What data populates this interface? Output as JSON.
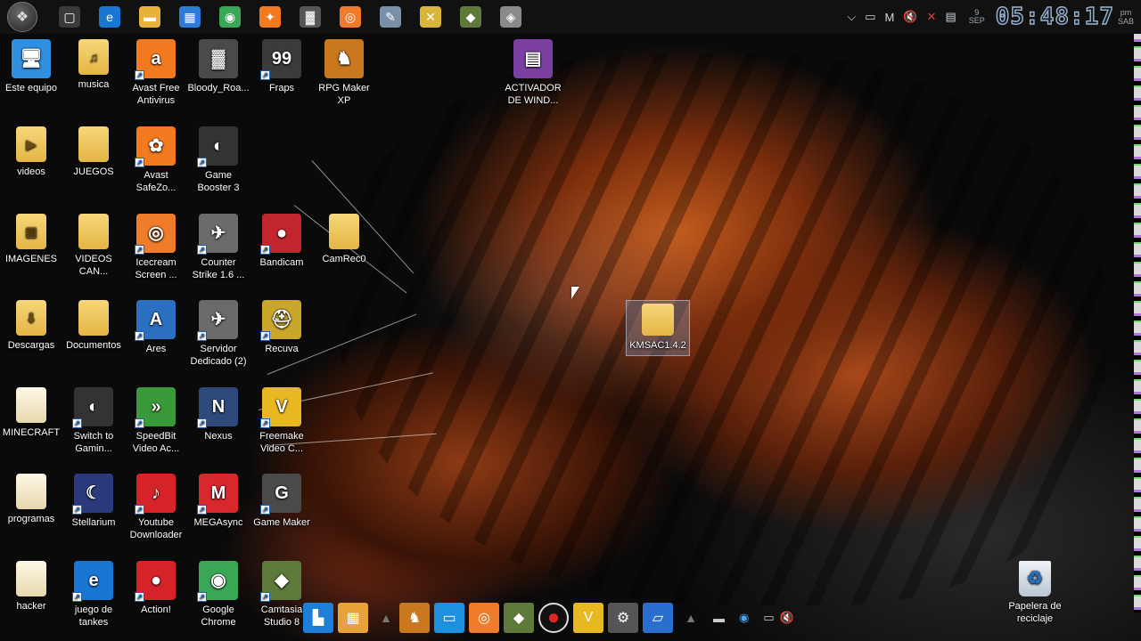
{
  "taskbar": {
    "start_icon": "windows-orb-icon",
    "pinned": [
      {
        "name": "task-view-icon",
        "glyph": "▢",
        "color": "#3a3a3a"
      },
      {
        "name": "edge-icon",
        "glyph": "e",
        "color": "#1976d2"
      },
      {
        "name": "file-explorer-icon",
        "glyph": "▬",
        "color": "#e8b23a"
      },
      {
        "name": "store-icon",
        "glyph": "▦",
        "color": "#2e7bd6"
      },
      {
        "name": "chrome-icon",
        "glyph": "◉",
        "color": "#3aa757"
      },
      {
        "name": "avast-icon",
        "glyph": "✦",
        "color": "#f47a20"
      },
      {
        "name": "bloody-roar-icon",
        "glyph": "▓",
        "color": "#555"
      },
      {
        "name": "icecream-icon",
        "glyph": "◎",
        "color": "#f07b2a"
      },
      {
        "name": "paint-icon",
        "glyph": "✎",
        "color": "#7a8fa8"
      },
      {
        "name": "tools-icon",
        "glyph": "✕",
        "color": "#d9b53a"
      },
      {
        "name": "camtasia-icon",
        "glyph": "◆",
        "color": "#5d7a3a"
      },
      {
        "name": "game-icon",
        "glyph": "◈",
        "color": "#8a8a8a"
      }
    ]
  },
  "tray": {
    "date_day": "9",
    "date_month": "SEP",
    "time": "05:48:17",
    "ampm_top": "pm",
    "ampm_bottom": "SAB"
  },
  "desktop_icons": [
    {
      "name": "icon-este-equipo",
      "label": "Este equipo",
      "glyph": "🖥",
      "bg": "#2f8fe0",
      "col": 0,
      "row": 0
    },
    {
      "name": "icon-musica",
      "label": "musica",
      "glyph": "♫",
      "bg": "folder",
      "col": 1,
      "row": 0
    },
    {
      "name": "icon-avast",
      "label": "Avast Free Antivirus",
      "glyph": "a",
      "bg": "#f47a20",
      "col": 2,
      "row": 0,
      "shortcut": true
    },
    {
      "name": "icon-bloody-roar",
      "label": "Bloody_Roa...",
      "glyph": "▓",
      "bg": "#4a4a4a",
      "col": 3,
      "row": 0
    },
    {
      "name": "icon-fraps",
      "label": "Fraps",
      "glyph": "99",
      "bg": "#3b3b3b",
      "col": 4,
      "row": 0,
      "shortcut": true
    },
    {
      "name": "icon-rpg-maker",
      "label": "RPG Maker XP",
      "glyph": "♞",
      "bg": "#c9781e",
      "col": 5,
      "row": 0
    },
    {
      "name": "icon-activador",
      "label": "ACTIVADOR DE WIND...",
      "glyph": "▤",
      "bg": "#7a3fa0",
      "col": 8,
      "row": 0
    },
    {
      "name": "icon-videos",
      "label": "videos",
      "glyph": "▶",
      "bg": "folder",
      "col": 0,
      "row": 1
    },
    {
      "name": "icon-juegos",
      "label": "JUEGOS",
      "glyph": "",
      "bg": "folder",
      "col": 1,
      "row": 1
    },
    {
      "name": "icon-avast-safezone",
      "label": "Avast SafeZo...",
      "glyph": "✿",
      "bg": "#f47a20",
      "col": 2,
      "row": 1,
      "shortcut": true
    },
    {
      "name": "icon-game-booster",
      "label": "Game Booster 3",
      "glyph": "◐",
      "bg": "#333",
      "col": 3,
      "row": 1,
      "shortcut": true
    },
    {
      "name": "icon-imagenes",
      "label": "IMAGENES",
      "glyph": "▧",
      "bg": "folder",
      "col": 0,
      "row": 2
    },
    {
      "name": "icon-videos-can",
      "label": "VIDEOS CAN...",
      "glyph": "",
      "bg": "folder",
      "col": 1,
      "row": 2
    },
    {
      "name": "icon-icecream",
      "label": "Icecream Screen ...",
      "glyph": "◎",
      "bg": "#f07b2a",
      "col": 2,
      "row": 2,
      "shortcut": true
    },
    {
      "name": "icon-counter-strike",
      "label": "Counter Strike 1.6 ...",
      "glyph": "✈",
      "bg": "#6b6b6b",
      "col": 3,
      "row": 2,
      "shortcut": true
    },
    {
      "name": "icon-bandicam",
      "label": "Bandicam",
      "glyph": "●",
      "bg": "#c0262c",
      "col": 4,
      "row": 2,
      "shortcut": true
    },
    {
      "name": "icon-camrec",
      "label": "CamRec0",
      "glyph": "",
      "bg": "folder",
      "col": 5,
      "row": 2
    },
    {
      "name": "icon-descargas",
      "label": "Descargas",
      "glyph": "⬇",
      "bg": "folder",
      "col": 0,
      "row": 3
    },
    {
      "name": "icon-documentos",
      "label": "Documentos",
      "glyph": "",
      "bg": "folder",
      "col": 1,
      "row": 3
    },
    {
      "name": "icon-ares",
      "label": "Ares",
      "glyph": "A",
      "bg": "#2a6fc0",
      "col": 2,
      "row": 3,
      "shortcut": true
    },
    {
      "name": "icon-servidor-dedicado",
      "label": "Servidor Dedicado (2)",
      "glyph": "✈",
      "bg": "#6b6b6b",
      "col": 3,
      "row": 3,
      "shortcut": true
    },
    {
      "name": "icon-recuva",
      "label": "Recuva",
      "glyph": "⛑",
      "bg": "#c9a62c",
      "col": 4,
      "row": 3,
      "shortcut": true
    },
    {
      "name": "icon-minecraft",
      "label": "MINECRAFT",
      "glyph": "",
      "bg": "folder-doc",
      "col": 0,
      "row": 4
    },
    {
      "name": "icon-switch-to-gaming",
      "label": "Switch to Gamin...",
      "glyph": "◐",
      "bg": "#333",
      "col": 1,
      "row": 4,
      "shortcut": true
    },
    {
      "name": "icon-speedbit",
      "label": "SpeedBit Video Ac...",
      "glyph": "»",
      "bg": "#3a9a3a",
      "col": 2,
      "row": 4,
      "shortcut": true
    },
    {
      "name": "icon-nexus",
      "label": "Nexus",
      "glyph": "N",
      "bg": "#2d4a7a",
      "col": 3,
      "row": 4,
      "shortcut": true
    },
    {
      "name": "icon-freemake",
      "label": "Freemake Video C...",
      "glyph": "V",
      "bg": "#e8b820",
      "col": 4,
      "row": 4,
      "shortcut": true
    },
    {
      "name": "icon-programas",
      "label": "programas",
      "glyph": "",
      "bg": "folder-doc",
      "col": 0,
      "row": 5
    },
    {
      "name": "icon-stellarium",
      "label": "Stellarium",
      "glyph": "☾",
      "bg": "#2b3a7a",
      "col": 1,
      "row": 5,
      "shortcut": true
    },
    {
      "name": "icon-youtube-downloader",
      "label": "Youtube Downloader",
      "glyph": "♪",
      "bg": "#d6232a",
      "col": 2,
      "row": 5,
      "shortcut": true
    },
    {
      "name": "icon-megasync",
      "label": "MEGAsync",
      "glyph": "M",
      "bg": "#d9272e",
      "col": 3,
      "row": 5,
      "shortcut": true
    },
    {
      "name": "icon-game-maker",
      "label": "Game Maker",
      "glyph": "G",
      "bg": "#4a4a4a",
      "col": 4,
      "row": 5,
      "shortcut": true
    },
    {
      "name": "icon-hacker",
      "label": "hacker",
      "glyph": "",
      "bg": "folder-doc",
      "col": 0,
      "row": 6
    },
    {
      "name": "icon-juego-de-tankes",
      "label": "juego de tankes",
      "glyph": "e",
      "bg": "#1976d2",
      "col": 1,
      "row": 6,
      "shortcut": true
    },
    {
      "name": "icon-action",
      "label": "Action!",
      "glyph": "●",
      "bg": "#d6232a",
      "col": 2,
      "row": 6,
      "shortcut": true
    },
    {
      "name": "icon-google-chrome",
      "label": "Google Chrome",
      "glyph": "◉",
      "bg": "#3aa757",
      "col": 3,
      "row": 6,
      "shortcut": true
    },
    {
      "name": "icon-camtasia-studio",
      "label": "Camtasia Studio 8",
      "glyph": "◆",
      "bg": "#5d7a3a",
      "col": 4,
      "row": 6,
      "shortcut": true
    }
  ],
  "selected_icon": {
    "name": "icon-kmsac",
    "label": "KMSAC1.4.2"
  },
  "recycle_bin": {
    "label": "Papelera de reciclaje"
  },
  "dock": [
    {
      "name": "dock-app1-icon",
      "glyph": "▙",
      "color": "#1e7fd8"
    },
    {
      "name": "dock-app2-icon",
      "glyph": "▦",
      "color": "#e8a23a"
    },
    {
      "name": "dock-rpg-maker-icon",
      "glyph": "♞",
      "color": "#c9781e"
    },
    {
      "name": "dock-desktop-icon",
      "glyph": "▭",
      "color": "#1e90e0"
    },
    {
      "name": "dock-icecream-icon",
      "glyph": "◎",
      "color": "#f07b2a"
    },
    {
      "name": "dock-camtasia-icon",
      "glyph": "◆",
      "color": "#5d7a3a"
    },
    {
      "name": "dock-record-icon",
      "glyph": "●",
      "color": "#111"
    },
    {
      "name": "dock-freemake-icon",
      "glyph": "V",
      "color": "#e8b820"
    },
    {
      "name": "dock-settings-icon",
      "glyph": "⚙",
      "color": "#555"
    },
    {
      "name": "dock-screen-icon",
      "glyph": "▱",
      "color": "#2a6fd0"
    }
  ]
}
